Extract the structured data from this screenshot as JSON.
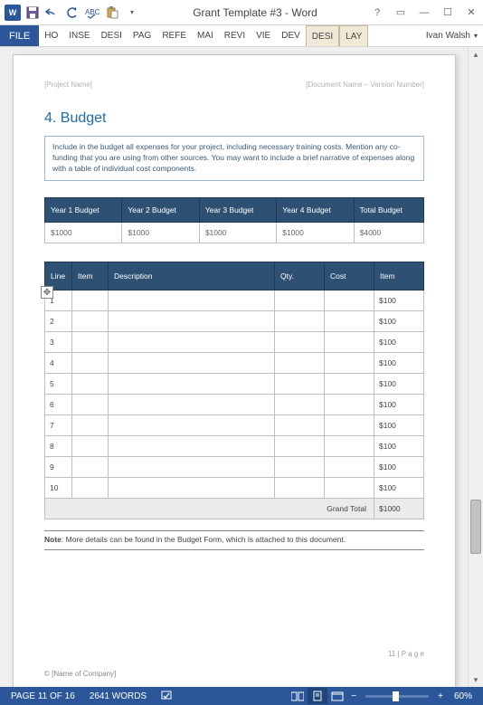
{
  "titlebar": {
    "title": "Grant Template #3 - Word"
  },
  "ribbon": {
    "file": "FILE",
    "tabs": [
      "HO",
      "INSE",
      "DESI",
      "PAG",
      "REFE",
      "MAI",
      "REVI",
      "VIE",
      "DEV",
      "DESI",
      "LAY"
    ],
    "user": "Ivan Walsh"
  },
  "page": {
    "header_left": "[Project Name]",
    "header_right": "[Document Name – Version Number]",
    "section_title": "4. Budget",
    "instruction": "Include in the budget all expenses for your project, including necessary training costs. Mention any co-funding that you are using from other sources. You may want to include a brief narrative of expenses along with a table of individual cost components.",
    "budget_headers": [
      "Year 1 Budget",
      "Year 2 Budget",
      "Year 3 Budget",
      "Year 4 Budget",
      "Total Budget"
    ],
    "budget_values": [
      "$1000",
      "$1000",
      "$1000",
      "$1000",
      "$4000"
    ],
    "line_headers": [
      "Line",
      "Item",
      "Description",
      "Qty.",
      "Cost",
      "Item"
    ],
    "rows": [
      {
        "line": "1",
        "item2": "$100"
      },
      {
        "line": "2",
        "item2": "$100"
      },
      {
        "line": "3",
        "item2": "$100"
      },
      {
        "line": "4",
        "item2": "$100"
      },
      {
        "line": "5",
        "item2": "$100"
      },
      {
        "line": "6",
        "item2": "$100"
      },
      {
        "line": "7",
        "item2": "$100"
      },
      {
        "line": "8",
        "item2": "$100"
      },
      {
        "line": "9",
        "item2": "$100"
      },
      {
        "line": "10",
        "item2": "$100"
      }
    ],
    "grand_total_label": "Grand Total",
    "grand_total_value": "$1000",
    "note_label": "Note",
    "note_text": ": More details can be found in the Budget Form, which is attached to this document.",
    "page_num": "11 | P a g e",
    "company": "© [Name of Company]"
  },
  "status": {
    "page": "PAGE 11 OF 16",
    "words": "2641 WORDS",
    "zoom": "60%"
  }
}
